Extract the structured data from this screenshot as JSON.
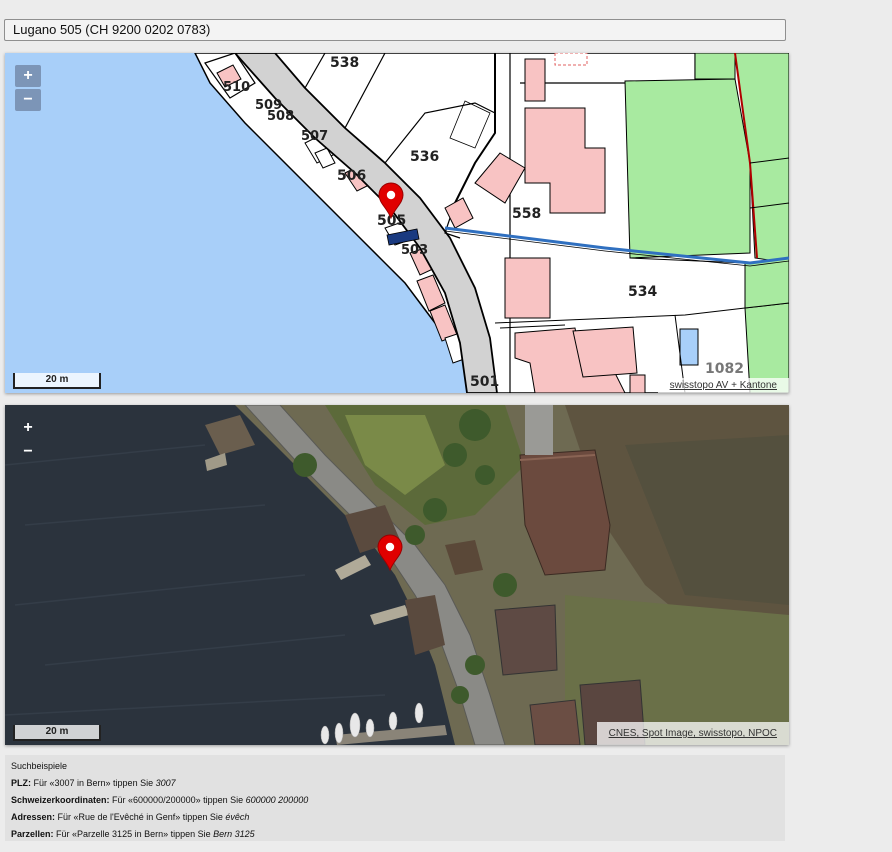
{
  "search": {
    "value": "Lugano 505 (CH 9200 0202 0783)"
  },
  "map_cadastral": {
    "parcel_labels": [
      "538",
      "510",
      "509",
      "508",
      "507",
      "536",
      "506",
      "505",
      "503",
      "558",
      "534",
      "501",
      "1082"
    ],
    "scale_label": "20 m",
    "attribution": "swisstopo AV + Kantone",
    "zoom_in": "+",
    "zoom_out": "−",
    "colors": {
      "water": "#a8cff9",
      "building": "#f8c3c3",
      "green": "#a8eaa0",
      "road": "#d2d2d2",
      "marker": "#e00000"
    }
  },
  "map_aerial": {
    "scale_label": "20 m",
    "attribution": "CNES, Spot Image, swisstopo, NPOC",
    "zoom_in": "+",
    "zoom_out": "−"
  },
  "examples": {
    "title": "Suchbeispiele",
    "rows": [
      {
        "label": "PLZ:",
        "text": " Für «3007 in Bern» tippen Sie ",
        "example": "3007"
      },
      {
        "label": "Schweizerkoordinaten:",
        "text": " Für «600000/200000» tippen Sie ",
        "example": "600000 200000"
      },
      {
        "label": "Adressen:",
        "text": " Für «Rue de l'Evêché in Genf» tippen Sie ",
        "example": "évêch"
      },
      {
        "label": "Parzellen:",
        "text": " Für «Parzelle 3125 in Bern» tippen Sie ",
        "example": "Bern 3125"
      }
    ]
  }
}
